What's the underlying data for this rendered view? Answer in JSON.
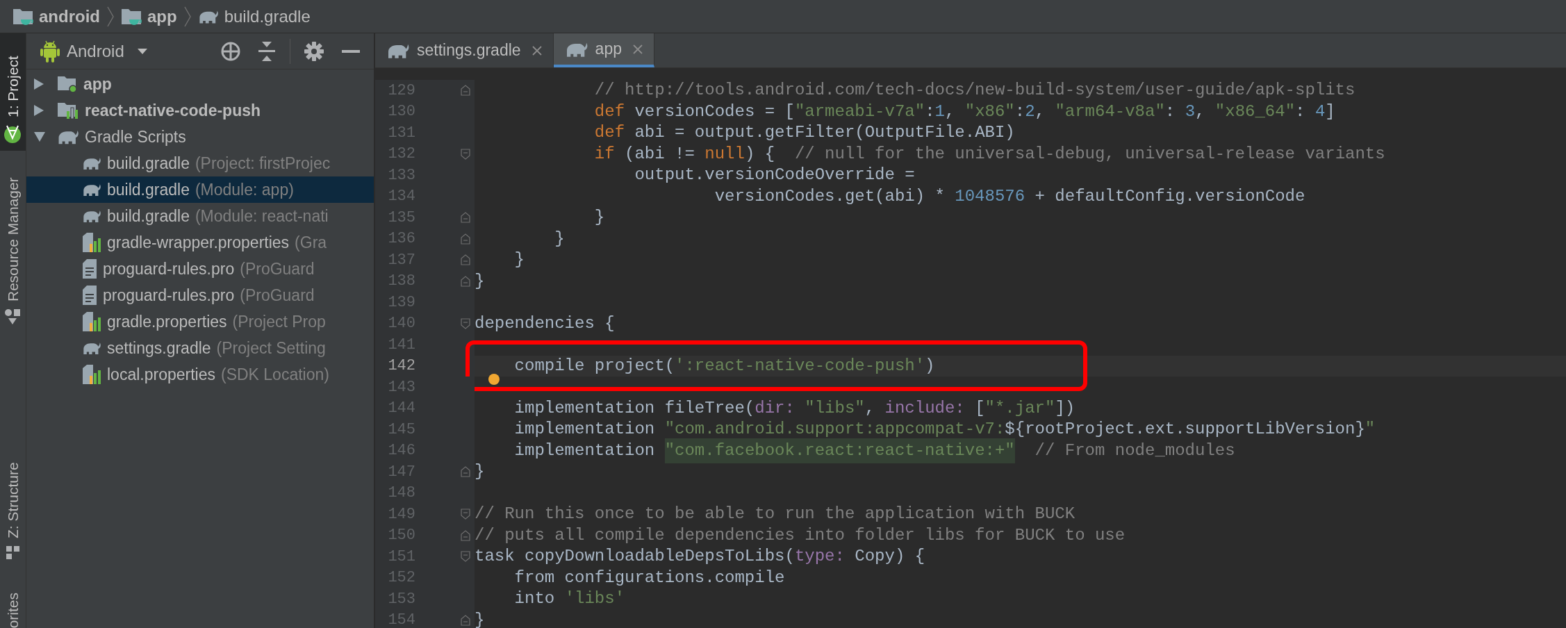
{
  "breadcrumb": [
    {
      "label": "android",
      "kind": "folder"
    },
    {
      "label": "app",
      "kind": "folder"
    },
    {
      "label": "build.gradle",
      "kind": "gradle"
    }
  ],
  "tool_windows": [
    {
      "label": "1: Project",
      "kind": "android-studio",
      "selected": true
    },
    {
      "label": "Resource Manager",
      "kind": "shapes",
      "selected": false
    },
    {
      "label": "Z: Structure",
      "kind": "structure",
      "selected": false
    },
    {
      "label": "orites",
      "kind": "plain",
      "selected": false
    }
  ],
  "project_panel": {
    "view": "Android",
    "tree": [
      {
        "label": "app",
        "kind": "module",
        "expanded": false,
        "selected": false
      },
      {
        "label": "react-native-code-push",
        "kind": "library",
        "expanded": false,
        "selected": false
      },
      {
        "label": "Gradle Scripts",
        "kind": "scripts",
        "expanded": true,
        "selected": false,
        "children": [
          {
            "label": "build.gradle",
            "detail": "(Project: firstProjec",
            "kind": "gradle",
            "selected": false
          },
          {
            "label": "build.gradle",
            "detail": "(Module: app)",
            "kind": "gradle",
            "selected": true
          },
          {
            "label": "build.gradle",
            "detail": "(Module: react-nati",
            "kind": "gradle",
            "selected": false
          },
          {
            "label": "gradle-wrapper.properties",
            "detail": "(Gra",
            "kind": "properties",
            "selected": false
          },
          {
            "label": "proguard-rules.pro",
            "detail": "(ProGuard",
            "kind": "text",
            "selected": false
          },
          {
            "label": "proguard-rules.pro",
            "detail": "(ProGuard",
            "kind": "text",
            "selected": false
          },
          {
            "label": "gradle.properties",
            "detail": "(Project Prop",
            "kind": "properties",
            "selected": false
          },
          {
            "label": "settings.gradle",
            "detail": "(Project Setting",
            "kind": "gradle",
            "selected": false
          },
          {
            "label": "local.properties",
            "detail": "(SDK Location)",
            "kind": "properties",
            "selected": false
          }
        ]
      }
    ]
  },
  "editor_tabs": [
    {
      "label": "settings.gradle",
      "selected": false
    },
    {
      "label": "app",
      "selected": true
    }
  ],
  "code_lines": [
    {
      "number": "129",
      "fold_end": true,
      "tokens": [
        {
          "kind": "comment",
          "text": "            // http://tools.android.com/tech-docs/new-build-system/user-guide/apk-splits"
        }
      ]
    },
    {
      "number": "130",
      "tokens": [
        {
          "kind": "kw",
          "text": "            def"
        },
        {
          "kind": "plain",
          "text": " versionCodes = ["
        },
        {
          "kind": "str",
          "text": "\"armeabi-v7a\""
        },
        {
          "kind": "plain",
          "text": ":"
        },
        {
          "kind": "num",
          "text": "1"
        },
        {
          "kind": "plain",
          "text": ", "
        },
        {
          "kind": "str",
          "text": "\"x86\""
        },
        {
          "kind": "plain",
          "text": ":"
        },
        {
          "kind": "num",
          "text": "2"
        },
        {
          "kind": "plain",
          "text": ", "
        },
        {
          "kind": "str",
          "text": "\"arm64-v8a\""
        },
        {
          "kind": "plain",
          "text": ": "
        },
        {
          "kind": "num",
          "text": "3"
        },
        {
          "kind": "plain",
          "text": ", "
        },
        {
          "kind": "str",
          "text": "\"x86_64\""
        },
        {
          "kind": "plain",
          "text": ": "
        },
        {
          "kind": "num",
          "text": "4"
        },
        {
          "kind": "plain",
          "text": "]"
        }
      ]
    },
    {
      "number": "131",
      "tokens": [
        {
          "kind": "kw",
          "text": "            def"
        },
        {
          "kind": "plain",
          "text": " abi = output.getFilter(OutputFile.ABI)"
        }
      ]
    },
    {
      "number": "132",
      "fold_start": true,
      "tokens": [
        {
          "kind": "kw",
          "text": "            if"
        },
        {
          "kind": "plain",
          "text": " (abi != "
        },
        {
          "kind": "kw",
          "text": "null"
        },
        {
          "kind": "plain",
          "text": ") {"
        },
        {
          "kind": "comment",
          "text": "  // null for the universal-debug, universal-release variants"
        }
      ]
    },
    {
      "number": "133",
      "tokens": [
        {
          "kind": "plain",
          "text": "                output.versionCodeOverride ="
        }
      ]
    },
    {
      "number": "134",
      "tokens": [
        {
          "kind": "plain",
          "text": "                        versionCodes.get(abi) * "
        },
        {
          "kind": "num",
          "text": "1048576"
        },
        {
          "kind": "plain",
          "text": " + defaultConfig.versionCode"
        }
      ]
    },
    {
      "number": "135",
      "fold_end": true,
      "tokens": [
        {
          "kind": "plain",
          "text": "            }"
        }
      ]
    },
    {
      "number": "136",
      "fold_end": true,
      "tokens": [
        {
          "kind": "plain",
          "text": "        }"
        }
      ]
    },
    {
      "number": "137",
      "fold_end": true,
      "tokens": [
        {
          "kind": "plain",
          "text": "    }"
        }
      ]
    },
    {
      "number": "138",
      "fold_end": true,
      "tokens": [
        {
          "kind": "plain",
          "text": "}"
        }
      ]
    },
    {
      "number": "139"
    },
    {
      "number": "140",
      "fold_start": true,
      "tokens": [
        {
          "kind": "plain",
          "text": "dependencies {"
        }
      ]
    },
    {
      "number": "141"
    },
    {
      "number": "142",
      "current": true,
      "boxed": true,
      "tokens": [
        {
          "kind": "plain",
          "text": "    compile project("
        },
        {
          "kind": "str",
          "text": "':react-native-code-push'"
        },
        {
          "kind": "plain",
          "text": ")"
        }
      ]
    },
    {
      "number": "143",
      "warning": true
    },
    {
      "number": "144",
      "tokens": [
        {
          "kind": "plain",
          "text": "    implementation fileTree("
        },
        {
          "kind": "arg",
          "text": "dir:"
        },
        {
          "kind": "str",
          "text": " \"libs\""
        },
        {
          "kind": "plain",
          "text": ", "
        },
        {
          "kind": "arg",
          "text": "include:"
        },
        {
          "kind": "plain",
          "text": " ["
        },
        {
          "kind": "str",
          "text": "\"*.jar\""
        },
        {
          "kind": "plain",
          "text": "])"
        }
      ]
    },
    {
      "number": "145",
      "tokens": [
        {
          "kind": "plain",
          "text": "    implementation "
        },
        {
          "kind": "str",
          "text": "\"com.android.support:appcompat-v7:"
        },
        {
          "kind": "plain",
          "text": "${rootProject.ext.supportLibVersion}"
        },
        {
          "kind": "str",
          "text": "\""
        }
      ]
    },
    {
      "number": "146",
      "tokens": [
        {
          "kind": "plain",
          "text": "    implementation "
        },
        {
          "kind": "str-hl",
          "text": "\"com.facebook.react:react-native:+\""
        },
        {
          "kind": "comment",
          "text": "  // From node_modules"
        }
      ]
    },
    {
      "number": "147",
      "fold_end": true,
      "tokens": [
        {
          "kind": "plain",
          "text": "}"
        }
      ]
    },
    {
      "number": "148"
    },
    {
      "number": "149",
      "fold_start": true,
      "tokens": [
        {
          "kind": "comment",
          "text": "// Run this once to be able to run the application with BUCK"
        }
      ]
    },
    {
      "number": "150",
      "fold_end": true,
      "tokens": [
        {
          "kind": "comment",
          "text": "// puts all compile dependencies into folder libs for BUCK to use"
        }
      ]
    },
    {
      "number": "151",
      "fold_start": true,
      "tokens": [
        {
          "kind": "plain",
          "text": "task copyDownloadableDepsToLibs("
        },
        {
          "kind": "arg",
          "text": "type:"
        },
        {
          "kind": "plain",
          "text": " Copy) {"
        }
      ]
    },
    {
      "number": "152",
      "tokens": [
        {
          "kind": "plain",
          "text": "    from configurations.compile"
        }
      ]
    },
    {
      "number": "153",
      "tokens": [
        {
          "kind": "plain",
          "text": "    into "
        },
        {
          "kind": "str",
          "text": "'libs'"
        }
      ]
    },
    {
      "number": "154",
      "fold_end": true,
      "tokens": [
        {
          "kind": "plain",
          "text": "}"
        }
      ]
    }
  ]
}
